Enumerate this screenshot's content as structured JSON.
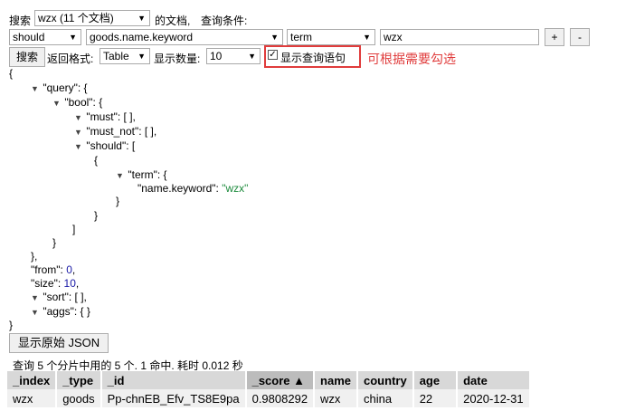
{
  "toolbar": {
    "search_label": "搜索",
    "index_select": "wzx (11 个文档)",
    "doc_label": "的文档,",
    "query_condition_label": "查询条件:",
    "bool_select": "should",
    "field_select": "goods.name.keyword",
    "op_select": "term",
    "value_input": "wzx",
    "add_label": "+",
    "remove_label": "-",
    "search_button": "搜索",
    "return_format_label": "返回格式:",
    "format_select": "Table",
    "show_count_label": "显示数量:",
    "count_select": "10",
    "show_query_label": "显示查询语句",
    "show_query_checked": true
  },
  "annotation": {
    "text": "可根据需要勾选",
    "color": "#e03c3c"
  },
  "query_json": {
    "l1": "{",
    "query": "\"query\": {",
    "bool": "\"bool\": {",
    "must": "\"must\": [ ],",
    "must_not": "\"must_not\": [ ],",
    "should": "\"should\": [",
    "obrace": "{",
    "term": "\"term\": {",
    "name_key": "\"name.keyword\": ",
    "name_val": "\"wzx\"",
    "cbrace": "}",
    "cbrace2": "}",
    "cbracket": "]",
    "cbrace3": "}",
    "cbrace_q": "},",
    "from_key": "\"from\": ",
    "from_val": "0",
    "from_comma": ",",
    "size_key": "\"size\": ",
    "size_val": "10",
    "size_comma": ",",
    "sort": "\"sort\": [ ],",
    "aggs": "\"aggs\": { }",
    "end": "}"
  },
  "raw_json_button": "显示原始 JSON",
  "status_text": "查询 5 个分片中用的 5 个. 1 命中. 耗时 0.012 秒",
  "table": {
    "headers": [
      "_index",
      "_type",
      "_id",
      "_score ▲",
      "name",
      "country",
      "age",
      "date"
    ],
    "rows": [
      [
        "wzx",
        "goods",
        "Pp-chnEB_Efv_TS8E9pa",
        "0.9808292",
        "wzx",
        "china",
        "22",
        "2020-12-31"
      ]
    ]
  },
  "icons": {
    "dropdown": "chevron-down-icon",
    "toggle": "triangle-down-icon"
  }
}
